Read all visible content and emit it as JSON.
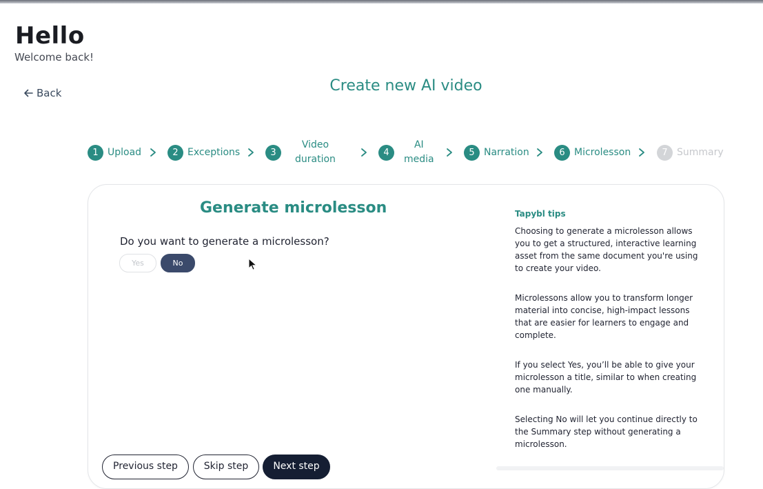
{
  "header": {
    "greeting": "Hello",
    "welcome": "Welcome back!"
  },
  "nav": {
    "back_label": "Back"
  },
  "page": {
    "title": "Create new AI video"
  },
  "stepper": {
    "steps": [
      {
        "number": "1",
        "label": "Upload",
        "state": "done"
      },
      {
        "number": "2",
        "label": "Exceptions",
        "state": "done"
      },
      {
        "number": "3",
        "label_line1": "Video",
        "label_line2": "duration",
        "state": "done"
      },
      {
        "number": "4",
        "label_line1": "AI",
        "label_line2": "media",
        "state": "done"
      },
      {
        "number": "5",
        "label": "Narration",
        "state": "done"
      },
      {
        "number": "6",
        "label": "Microlesson",
        "state": "current"
      },
      {
        "number": "7",
        "label": "Summary",
        "state": "disabled"
      }
    ]
  },
  "form": {
    "title": "Generate microlesson",
    "question": "Do you want to generate a microlesson?",
    "yes_label": "Yes",
    "no_label": "No",
    "selected": "No"
  },
  "tips": {
    "title": "Tapybl tips",
    "paragraphs": [
      "Choosing to generate a microlesson allows you to get a structured, interactive learning asset from the same document you're using to create your video.",
      "Microlessons allow you to transform longer material into concise, high-impact lessons that are easier for learners to engage and complete.",
      "If you select Yes, you’ll be able to give your microlesson a title, similar to when creating one manually.",
      "Selecting No will let you continue directly to the Summary step without generating a microlesson."
    ]
  },
  "actions": {
    "previous_label": "Previous step",
    "skip_label": "Skip step",
    "next_label": "Next step"
  },
  "colors": {
    "accent": "#2a8c83",
    "selected_pill": "#3b4a6b",
    "primary_button": "#151e33",
    "disabled_step": "#d3d5d8"
  },
  "icons": {
    "back": "arrow-left-icon",
    "separator": "chevron-right-icon",
    "cursor": "mouse-pointer-icon"
  }
}
